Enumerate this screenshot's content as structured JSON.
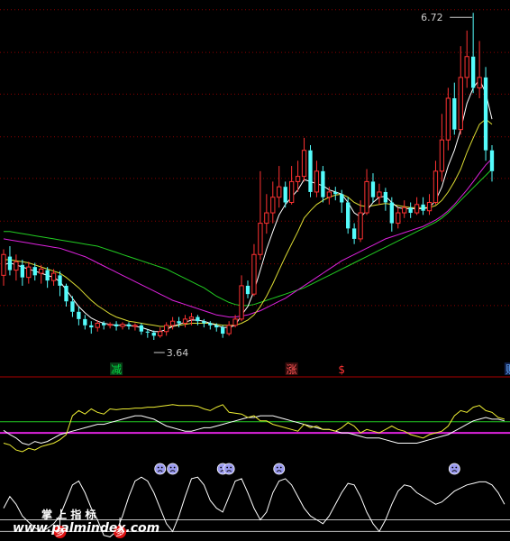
{
  "chart_data": {
    "type": "candlestick",
    "price": {
      "max_label": "6.72",
      "min_label": "3.64",
      "ylim": [
        3.45,
        6.8
      ],
      "grid_levels": [
        3.91,
        4.31,
        4.72,
        5.13,
        5.53,
        5.94,
        6.34,
        6.75
      ],
      "candles": [
        [
          4.2,
          4.4,
          4.1,
          4.45
        ],
        [
          4.38,
          4.25,
          4.2,
          4.48
        ],
        [
          4.25,
          4.33,
          4.15,
          4.4
        ],
        [
          4.3,
          4.18,
          4.1,
          4.35
        ],
        [
          4.18,
          4.28,
          4.12,
          4.33
        ],
        [
          4.28,
          4.2,
          4.15,
          4.32
        ],
        [
          4.22,
          4.26,
          4.12,
          4.3
        ],
        [
          4.25,
          4.15,
          4.08,
          4.28
        ],
        [
          4.15,
          4.22,
          4.1,
          4.26
        ],
        [
          4.2,
          4.1,
          4.0,
          4.24
        ],
        [
          4.1,
          3.95,
          3.9,
          4.12
        ],
        [
          3.95,
          3.85,
          3.8,
          4.0
        ],
        [
          3.85,
          3.78,
          3.72,
          3.9
        ],
        [
          3.78,
          3.72,
          3.68,
          3.82
        ],
        [
          3.72,
          3.7,
          3.64,
          3.76
        ],
        [
          3.7,
          3.74,
          3.66,
          3.77
        ],
        [
          3.74,
          3.72,
          3.68,
          3.76
        ],
        [
          3.72,
          3.73,
          3.69,
          3.75
        ],
        [
          3.73,
          3.71,
          3.67,
          3.76
        ],
        [
          3.71,
          3.73,
          3.68,
          3.75
        ],
        [
          3.73,
          3.71,
          3.68,
          3.75
        ],
        [
          3.71,
          3.72,
          3.67,
          3.74
        ],
        [
          3.72,
          3.66,
          3.63,
          3.74
        ],
        [
          3.66,
          3.65,
          3.6,
          3.68
        ],
        [
          3.65,
          3.62,
          3.58,
          3.67
        ],
        [
          3.62,
          3.66,
          3.6,
          3.7
        ],
        [
          3.66,
          3.72,
          3.62,
          3.75
        ],
        [
          3.72,
          3.76,
          3.68,
          3.8
        ],
        [
          3.76,
          3.74,
          3.7,
          3.8
        ],
        [
          3.74,
          3.78,
          3.7,
          3.82
        ],
        [
          3.78,
          3.8,
          3.72,
          3.84
        ],
        [
          3.8,
          3.76,
          3.72,
          3.82
        ],
        [
          3.76,
          3.74,
          3.7,
          3.78
        ],
        [
          3.74,
          3.72,
          3.68,
          3.76
        ],
        [
          3.72,
          3.7,
          3.66,
          3.74
        ],
        [
          3.7,
          3.64,
          3.6,
          3.72
        ],
        [
          3.64,
          3.72,
          3.62,
          3.76
        ],
        [
          3.72,
          3.78,
          3.7,
          3.82
        ],
        [
          3.78,
          4.1,
          3.76,
          4.2
        ],
        [
          4.1,
          4.02,
          3.98,
          4.15
        ],
        [
          4.02,
          4.4,
          4.0,
          4.5
        ],
        [
          4.4,
          4.7,
          4.35,
          5.2
        ],
        [
          4.7,
          4.8,
          4.6,
          4.98
        ],
        [
          4.8,
          4.95,
          4.7,
          5.1
        ],
        [
          4.95,
          5.05,
          4.85,
          5.25
        ],
        [
          5.05,
          4.9,
          4.85,
          5.1
        ],
        [
          4.9,
          5.1,
          4.88,
          5.25
        ],
        [
          5.1,
          5.15,
          5.0,
          5.3
        ],
        [
          5.15,
          5.4,
          5.1,
          5.52
        ],
        [
          5.4,
          5.0,
          4.95,
          5.45
        ],
        [
          5.0,
          5.2,
          4.95,
          5.3
        ],
        [
          5.2,
          4.95,
          4.9,
          5.25
        ],
        [
          4.95,
          5.0,
          4.88,
          5.05
        ],
        [
          5.0,
          4.98,
          4.92,
          5.05
        ],
        [
          4.98,
          4.9,
          4.8,
          5.02
        ],
        [
          4.9,
          4.65,
          4.6,
          4.95
        ],
        [
          4.65,
          4.55,
          4.5,
          4.7
        ],
        [
          4.55,
          4.8,
          4.52,
          4.92
        ],
        [
          4.8,
          5.1,
          4.78,
          5.22
        ],
        [
          5.1,
          4.95,
          4.9,
          5.18
        ],
        [
          4.95,
          5.0,
          4.88,
          5.08
        ],
        [
          5.0,
          4.9,
          4.82,
          5.04
        ],
        [
          4.9,
          4.7,
          4.62,
          4.95
        ],
        [
          4.7,
          4.8,
          4.65,
          4.85
        ],
        [
          4.8,
          4.85,
          4.75,
          4.92
        ],
        [
          4.85,
          4.8,
          4.75,
          4.9
        ],
        [
          4.8,
          4.88,
          4.78,
          4.95
        ],
        [
          4.88,
          4.82,
          4.78,
          4.95
        ],
        [
          4.82,
          4.9,
          4.78,
          4.98
        ],
        [
          4.9,
          5.2,
          4.88,
          5.3
        ],
        [
          5.2,
          5.5,
          5.1,
          5.75
        ],
        [
          5.5,
          5.9,
          5.4,
          6.0
        ],
        [
          5.9,
          5.6,
          5.55,
          6.05
        ],
        [
          5.6,
          6.1,
          5.55,
          6.4
        ],
        [
          6.1,
          6.3,
          6.0,
          6.55
        ],
        [
          6.3,
          6.0,
          5.95,
          6.72
        ],
        [
          6.0,
          6.1,
          5.9,
          6.45
        ],
        [
          6.1,
          5.4,
          5.3,
          6.2
        ],
        [
          5.4,
          5.2,
          5.1,
          5.45
        ]
      ],
      "ma_short": [
        4.3,
        4.32,
        4.3,
        4.28,
        4.26,
        4.24,
        4.22,
        4.2,
        4.18,
        4.14,
        4.06,
        3.98,
        3.9,
        3.84,
        3.79,
        3.76,
        3.74,
        3.73,
        3.72,
        3.72,
        3.72,
        3.71,
        3.7,
        3.68,
        3.66,
        3.66,
        3.68,
        3.71,
        3.73,
        3.75,
        3.77,
        3.77,
        3.76,
        3.74,
        3.72,
        3.7,
        3.7,
        3.72,
        3.82,
        3.9,
        4.05,
        4.25,
        4.45,
        4.62,
        4.78,
        4.88,
        4.95,
        5.02,
        5.12,
        5.1,
        5.08,
        5.06,
        5.02,
        5.0,
        4.98,
        4.9,
        4.8,
        4.76,
        4.82,
        4.9,
        4.95,
        4.96,
        4.9,
        4.85,
        4.84,
        4.84,
        4.84,
        4.84,
        4.85,
        4.92,
        5.05,
        5.25,
        5.4,
        5.6,
        5.85,
        6.0,
        6.08,
        5.95,
        5.7
      ],
      "ma_mid": [
        4.35,
        4.35,
        4.34,
        4.33,
        4.32,
        4.3,
        4.28,
        4.26,
        4.24,
        4.22,
        4.18,
        4.13,
        4.08,
        4.02,
        3.96,
        3.91,
        3.87,
        3.83,
        3.8,
        3.78,
        3.76,
        3.75,
        3.74,
        3.73,
        3.72,
        3.71,
        3.71,
        3.71,
        3.72,
        3.73,
        3.74,
        3.74,
        3.74,
        3.74,
        3.73,
        3.72,
        3.72,
        3.72,
        3.74,
        3.77,
        3.82,
        3.9,
        4.0,
        4.12,
        4.25,
        4.38,
        4.5,
        4.62,
        4.75,
        4.82,
        4.88,
        4.92,
        4.95,
        4.97,
        4.98,
        4.95,
        4.9,
        4.87,
        4.86,
        4.87,
        4.88,
        4.89,
        4.88,
        4.87,
        4.86,
        4.85,
        4.85,
        4.85,
        4.85,
        4.87,
        4.92,
        5.0,
        5.1,
        5.22,
        5.38,
        5.52,
        5.65,
        5.7,
        5.65
      ],
      "ma_long": [
        4.55,
        4.54,
        4.53,
        4.52,
        4.51,
        4.5,
        4.49,
        4.48,
        4.47,
        4.46,
        4.44,
        4.42,
        4.4,
        4.38,
        4.35,
        4.32,
        4.29,
        4.26,
        4.23,
        4.2,
        4.17,
        4.14,
        4.11,
        4.08,
        4.05,
        4.02,
        3.99,
        3.96,
        3.94,
        3.92,
        3.9,
        3.88,
        3.86,
        3.84,
        3.82,
        3.81,
        3.8,
        3.8,
        3.81,
        3.82,
        3.84,
        3.86,
        3.89,
        3.92,
        3.95,
        3.98,
        4.02,
        4.06,
        4.1,
        4.14,
        4.18,
        4.22,
        4.26,
        4.3,
        4.34,
        4.37,
        4.4,
        4.43,
        4.46,
        4.49,
        4.52,
        4.55,
        4.57,
        4.59,
        4.61,
        4.63,
        4.65,
        4.67,
        4.7,
        4.73,
        4.77,
        4.82,
        4.88,
        4.95,
        5.02,
        5.1,
        5.18,
        5.26,
        5.32
      ],
      "ma_slow": [
        4.62,
        4.62,
        4.61,
        4.6,
        4.59,
        4.58,
        4.57,
        4.56,
        4.55,
        4.54,
        4.53,
        4.52,
        4.51,
        4.5,
        4.49,
        4.48,
        4.46,
        4.44,
        4.42,
        4.4,
        4.38,
        4.36,
        4.34,
        4.32,
        4.3,
        4.28,
        4.26,
        4.23,
        4.2,
        4.17,
        4.14,
        4.11,
        4.08,
        4.04,
        4.0,
        3.97,
        3.94,
        3.92,
        3.91,
        3.91,
        3.92,
        3.94,
        3.96,
        3.98,
        4.0,
        4.02,
        4.04,
        4.06,
        4.08,
        4.11,
        4.14,
        4.17,
        4.2,
        4.23,
        4.26,
        4.29,
        4.32,
        4.35,
        4.38,
        4.41,
        4.44,
        4.47,
        4.5,
        4.53,
        4.56,
        4.59,
        4.62,
        4.65,
        4.68,
        4.71,
        4.75,
        4.8,
        4.86,
        4.92,
        4.98,
        5.04,
        5.1,
        5.16,
        5.22
      ],
      "marks": [
        {
          "text": "减",
          "index": 18,
          "color": "#00dd44",
          "bg": "#0a3a16"
        },
        {
          "text": "涨",
          "index": 46,
          "color": "#ff5555",
          "bg": "#3a0d0d"
        },
        {
          "text": "$",
          "index": 54,
          "color": "#ff3333",
          "bg": ""
        },
        {
          "text": "财",
          "index": 81,
          "color": "#66aaff",
          "bg": "#10204a"
        }
      ]
    },
    "indicator": {
      "ylim": [
        0,
        100
      ],
      "green_level": 55,
      "magenta_level": 42,
      "yellow": [
        30,
        28,
        22,
        20,
        24,
        22,
        26,
        28,
        30,
        34,
        40,
        62,
        68,
        64,
        70,
        66,
        64,
        70,
        69,
        70,
        70,
        71,
        71,
        72,
        72,
        73,
        74,
        75,
        74,
        74,
        74,
        73,
        70,
        68,
        72,
        75,
        66,
        65,
        64,
        60,
        62,
        56,
        56,
        52,
        50,
        48,
        46,
        44,
        52,
        48,
        50,
        46,
        46,
        44,
        48,
        54,
        50,
        42,
        46,
        44,
        42,
        46,
        50,
        46,
        44,
        40,
        38,
        36,
        40,
        42,
        44,
        50,
        62,
        68,
        66,
        72,
        74,
        68,
        66,
        60,
        58
      ],
      "white": [
        45,
        40,
        36,
        30,
        28,
        32,
        30,
        32,
        36,
        40,
        42,
        44,
        46,
        48,
        50,
        52,
        52,
        54,
        56,
        58,
        60,
        62,
        62,
        60,
        58,
        54,
        50,
        48,
        46,
        44,
        44,
        46,
        48,
        48,
        50,
        52,
        54,
        56,
        58,
        60,
        60,
        62,
        62,
        62,
        60,
        58,
        56,
        54,
        52,
        50,
        48,
        46,
        46,
        44,
        42,
        42,
        40,
        38,
        36,
        36,
        36,
        34,
        32,
        30,
        30,
        30,
        30,
        32,
        34,
        36,
        38,
        40,
        44,
        48,
        52,
        56,
        58,
        60,
        58,
        58,
        56
      ]
    },
    "oscillator": {
      "ylim": [
        0,
        100
      ],
      "levels": [
        10,
        25
      ],
      "white": [
        40,
        55,
        45,
        30,
        22,
        15,
        10,
        14,
        20,
        30,
        50,
        70,
        75,
        60,
        40,
        25,
        5,
        3,
        10,
        30,
        55,
        75,
        80,
        75,
        60,
        40,
        20,
        10,
        30,
        55,
        78,
        80,
        70,
        50,
        40,
        35,
        55,
        75,
        78,
        60,
        40,
        25,
        35,
        60,
        75,
        78,
        70,
        55,
        40,
        30,
        25,
        20,
        30,
        45,
        60,
        72,
        70,
        55,
        35,
        20,
        10,
        25,
        45,
        62,
        70,
        68,
        60,
        55,
        50,
        45,
        48,
        55,
        62,
        66,
        70,
        72,
        74,
        74,
        70,
        60,
        45
      ],
      "faces": [
        25,
        27,
        35,
        36,
        44,
        72
      ],
      "arrow_marks": [
        {
          "text": "多",
          "index": 9,
          "offset": 0
        },
        {
          "text": "多",
          "index": 18,
          "offset": 4
        }
      ]
    },
    "watermark": {
      "line1": "掌 上 指 标",
      "line2": "www.palmindex.com"
    }
  }
}
